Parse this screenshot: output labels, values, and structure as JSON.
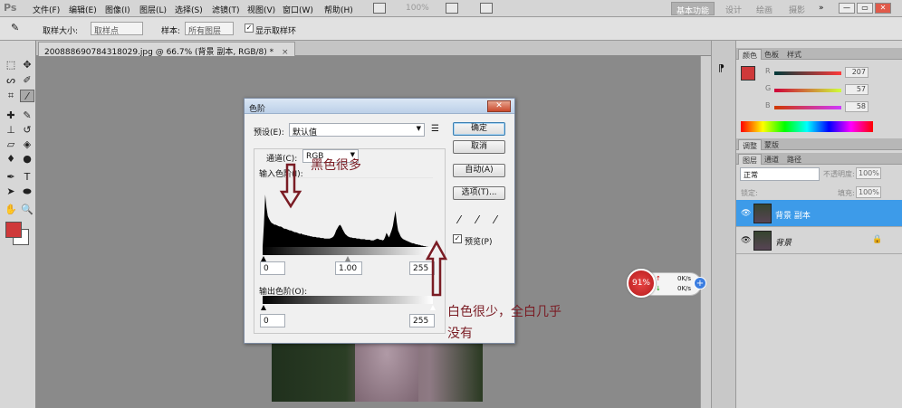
{
  "menubar": {
    "logo": "Ps",
    "menus": [
      "文件(F)",
      "编辑(E)",
      "图像(I)",
      "图层(L)",
      "选择(S)",
      "滤镜(T)",
      "视图(V)",
      "窗口(W)",
      "帮助(H)"
    ],
    "zoom": "100%",
    "workspaces": [
      "基本功能",
      "设计",
      "绘画",
      "摄影"
    ],
    "more": "»",
    "win_min": "—",
    "win_max": "▭",
    "win_close": "✕"
  },
  "options": {
    "sample_size_label": "取样大小:",
    "sample_size_value": "取样点",
    "sample_label": "样本:",
    "sample_value": "所有图层",
    "show_ring_label": "显示取样环",
    "show_ring_checked": "✓"
  },
  "document": {
    "tab_title": "20088869078431802​9.jpg @ 66.7% (背景 副本, RGB/8) *",
    "close": "×"
  },
  "levels_dialog": {
    "title": "色阶",
    "close": "✕",
    "preset_label": "预设(E):",
    "preset_value": "默认值",
    "channel_label": "通道(C):",
    "channel_value": "RGB",
    "input_levels_label": "输入色阶(I):",
    "output_levels_label": "输出色阶(O):",
    "input_black": "0",
    "input_gamma": "1.00",
    "input_white": "255",
    "output_black": "0",
    "output_white": "255",
    "ok": "确定",
    "cancel": "取消",
    "auto": "自动(A)",
    "options": "选项(T)...",
    "preview_label": "预览(P)",
    "preview_checked": "✓",
    "histogram": [
      2,
      40,
      92,
      70,
      55,
      50,
      46,
      43,
      42,
      40,
      40,
      39,
      38,
      37,
      37,
      36,
      34,
      33,
      33,
      32,
      31,
      30,
      30,
      29,
      28,
      27,
      27,
      26,
      25,
      24,
      25,
      23,
      23,
      22,
      22,
      21,
      21,
      20,
      20,
      19,
      19,
      19,
      18,
      18,
      18,
      17,
      17,
      17,
      16,
      16,
      16,
      16,
      16,
      17,
      18,
      20,
      24,
      30,
      34,
      38,
      40,
      37,
      32,
      28,
      24,
      22,
      20,
      19,
      18,
      18,
      17,
      17,
      17,
      16,
      16,
      16,
      15,
      15,
      15,
      15,
      14,
      14,
      14,
      14,
      13,
      13,
      13,
      14,
      15,
      16,
      15,
      14,
      14,
      13,
      14,
      19,
      26,
      22,
      18,
      24,
      30,
      38,
      52,
      64,
      44,
      30,
      25,
      20,
      17,
      15,
      14,
      13,
      12,
      11,
      10,
      9,
      8,
      8,
      7,
      6,
      6,
      5,
      5,
      4,
      4,
      3,
      3,
      2,
      2,
      1,
      1,
      1,
      0
    ]
  },
  "annotations": {
    "black": "黑色很多",
    "white_line1": "白色很少，全白几乎",
    "white_line2": "没有"
  },
  "color_panel": {
    "tabs": [
      "颜色",
      "色板",
      "样式"
    ],
    "r_label": "R",
    "g_label": "G",
    "b_label": "B",
    "r": "207",
    "g": "57",
    "b": "58",
    "fg_color": "#cf393a"
  },
  "adjust_panel": {
    "tabs": [
      "调整",
      "蒙版"
    ]
  },
  "layers_panel": {
    "tabs": [
      "图层",
      "通道",
      "路径"
    ],
    "blend_mode": "正常",
    "opacity_label": "不透明度:",
    "opacity": "100%",
    "lock_label": "锁定:",
    "fill_label": "填充:",
    "fill": "100%",
    "layers": [
      {
        "name": "背景 副本",
        "selected": true
      },
      {
        "name": "背景",
        "selected": false
      }
    ]
  },
  "speed_widget": {
    "percent": "91%",
    "up": "0K/s",
    "down": "0K/s",
    "plus": "+"
  }
}
